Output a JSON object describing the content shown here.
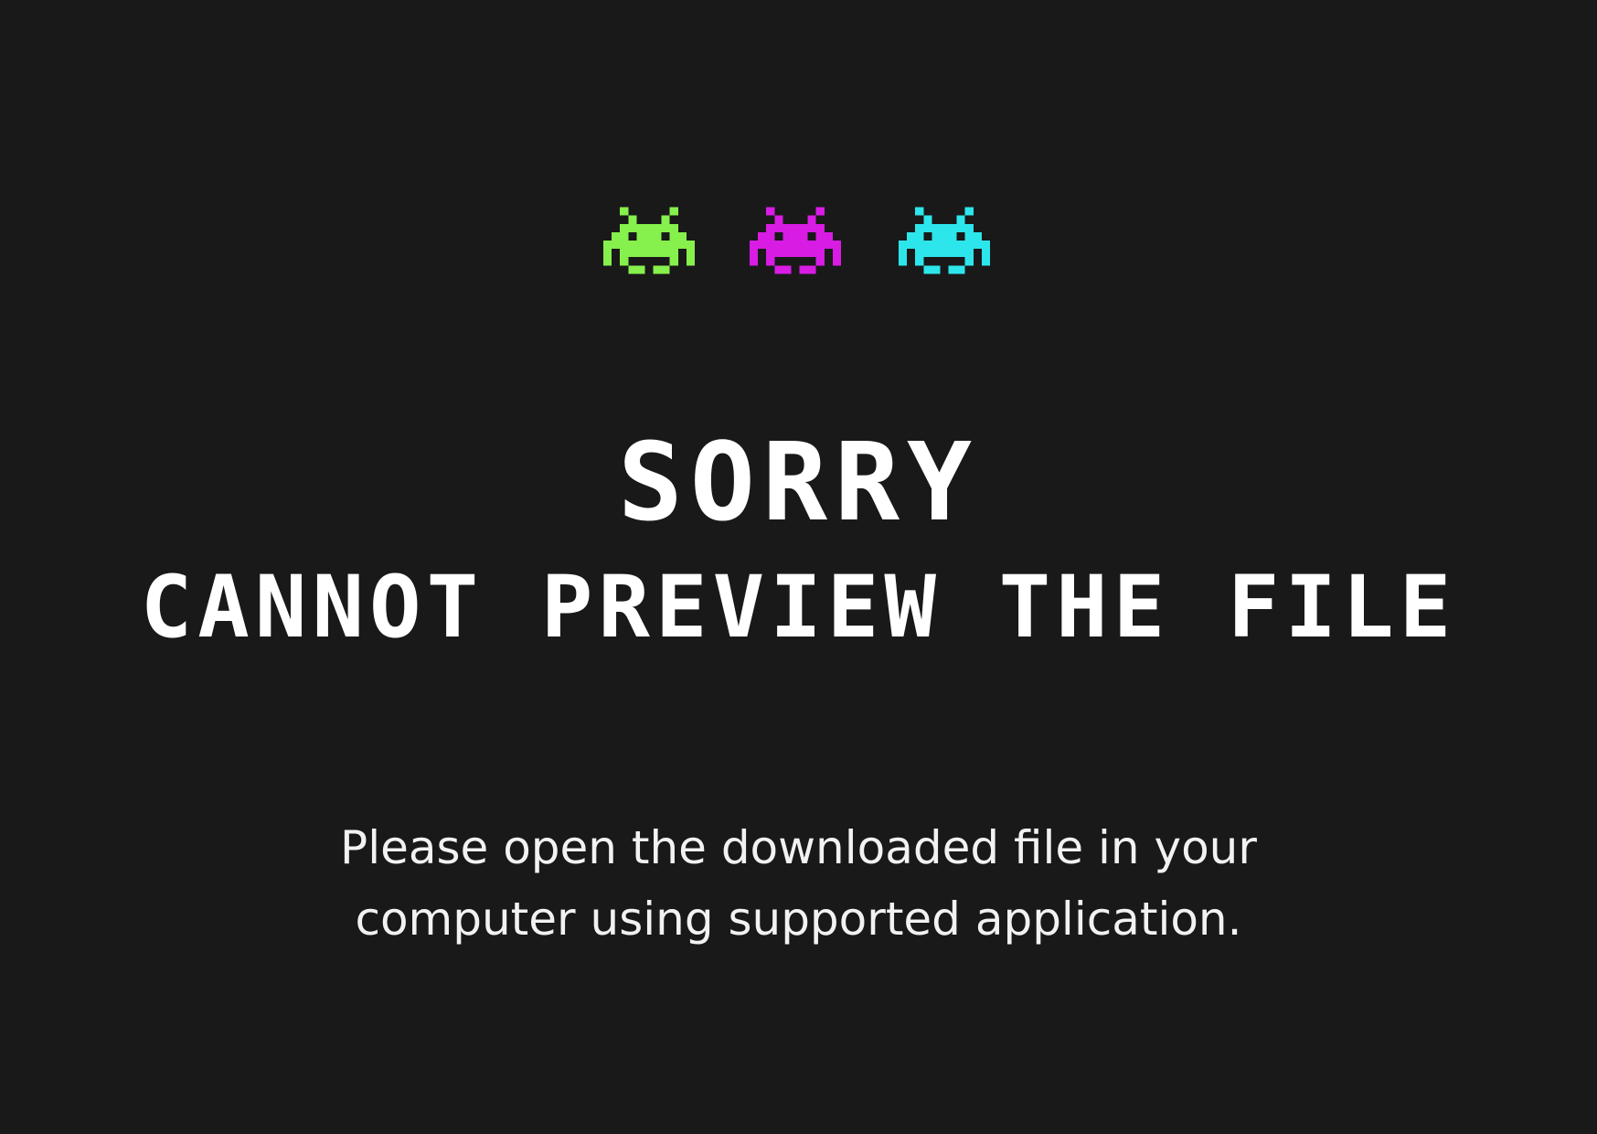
{
  "colors": {
    "background": "#1a1a1a",
    "grid_cell": "#1e1e1e",
    "text": "#ffffff",
    "invader_green": "#86f04d",
    "invader_magenta": "#d81ce4",
    "invader_cyan": "#2de6ec"
  },
  "invaders": [
    {
      "name": "green-invader-icon",
      "color": "#86f04d"
    },
    {
      "name": "magenta-invader-icon",
      "color": "#d81ce4"
    },
    {
      "name": "cyan-invader-icon",
      "color": "#2de6ec"
    }
  ],
  "headline": {
    "line1": "SORRY",
    "line2": "CANNOT PREVIEW THE FILE"
  },
  "message": {
    "line1": "Please open the downloaded file in your",
    "line2": "computer using supported application."
  }
}
